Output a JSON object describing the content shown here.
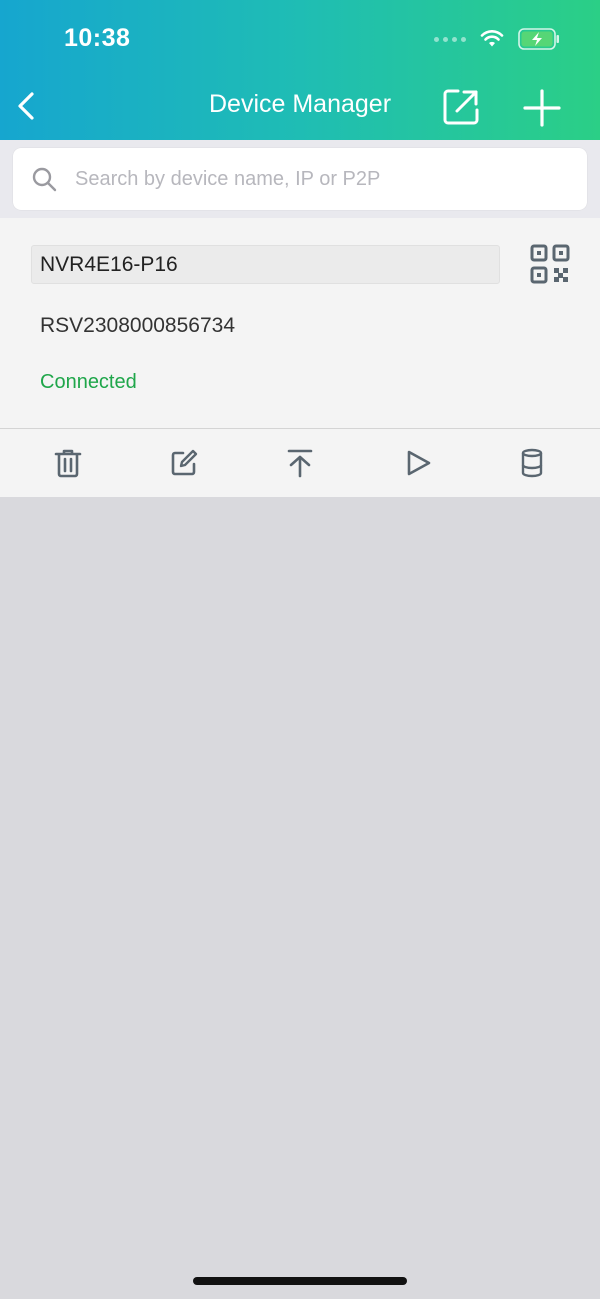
{
  "status_bar": {
    "time": "10:38"
  },
  "nav": {
    "title": "Device Manager",
    "back_icon": "chevron-left-icon",
    "share_icon": "share-icon",
    "add_icon": "plus-icon"
  },
  "search": {
    "placeholder": "Search by device name, IP or P2P",
    "value": ""
  },
  "device": {
    "name": "NVR4E16-P16",
    "serial": "RSV2308000856734",
    "status": "Connected",
    "status_color": "#1fa64a"
  },
  "actions": [
    "trash-icon",
    "edit-icon",
    "upload-icon",
    "play-icon",
    "storage-icon"
  ],
  "colors": {
    "header_start": "#16a6cf",
    "header_end": "#2bcf86",
    "icon_gray": "#5a6670"
  }
}
